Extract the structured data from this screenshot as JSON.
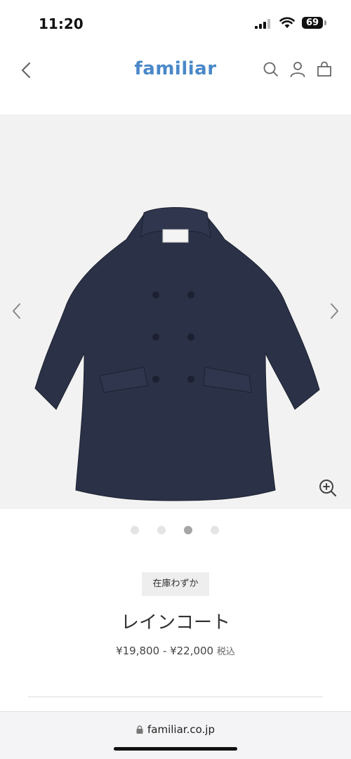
{
  "status_bar": {
    "time": "11:20",
    "battery": "69"
  },
  "header": {
    "logo": "familiar"
  },
  "gallery": {
    "slide_count": 4,
    "active_index": 2
  },
  "product": {
    "stock_label": "在庫わずか",
    "title": "レインコート",
    "price": "¥19,800 - ¥22,000",
    "tax_label": "税込"
  },
  "browser": {
    "url": "familiar.co.jp"
  },
  "colors": {
    "brand": "#4a88c8",
    "coat": "#2b3146"
  }
}
